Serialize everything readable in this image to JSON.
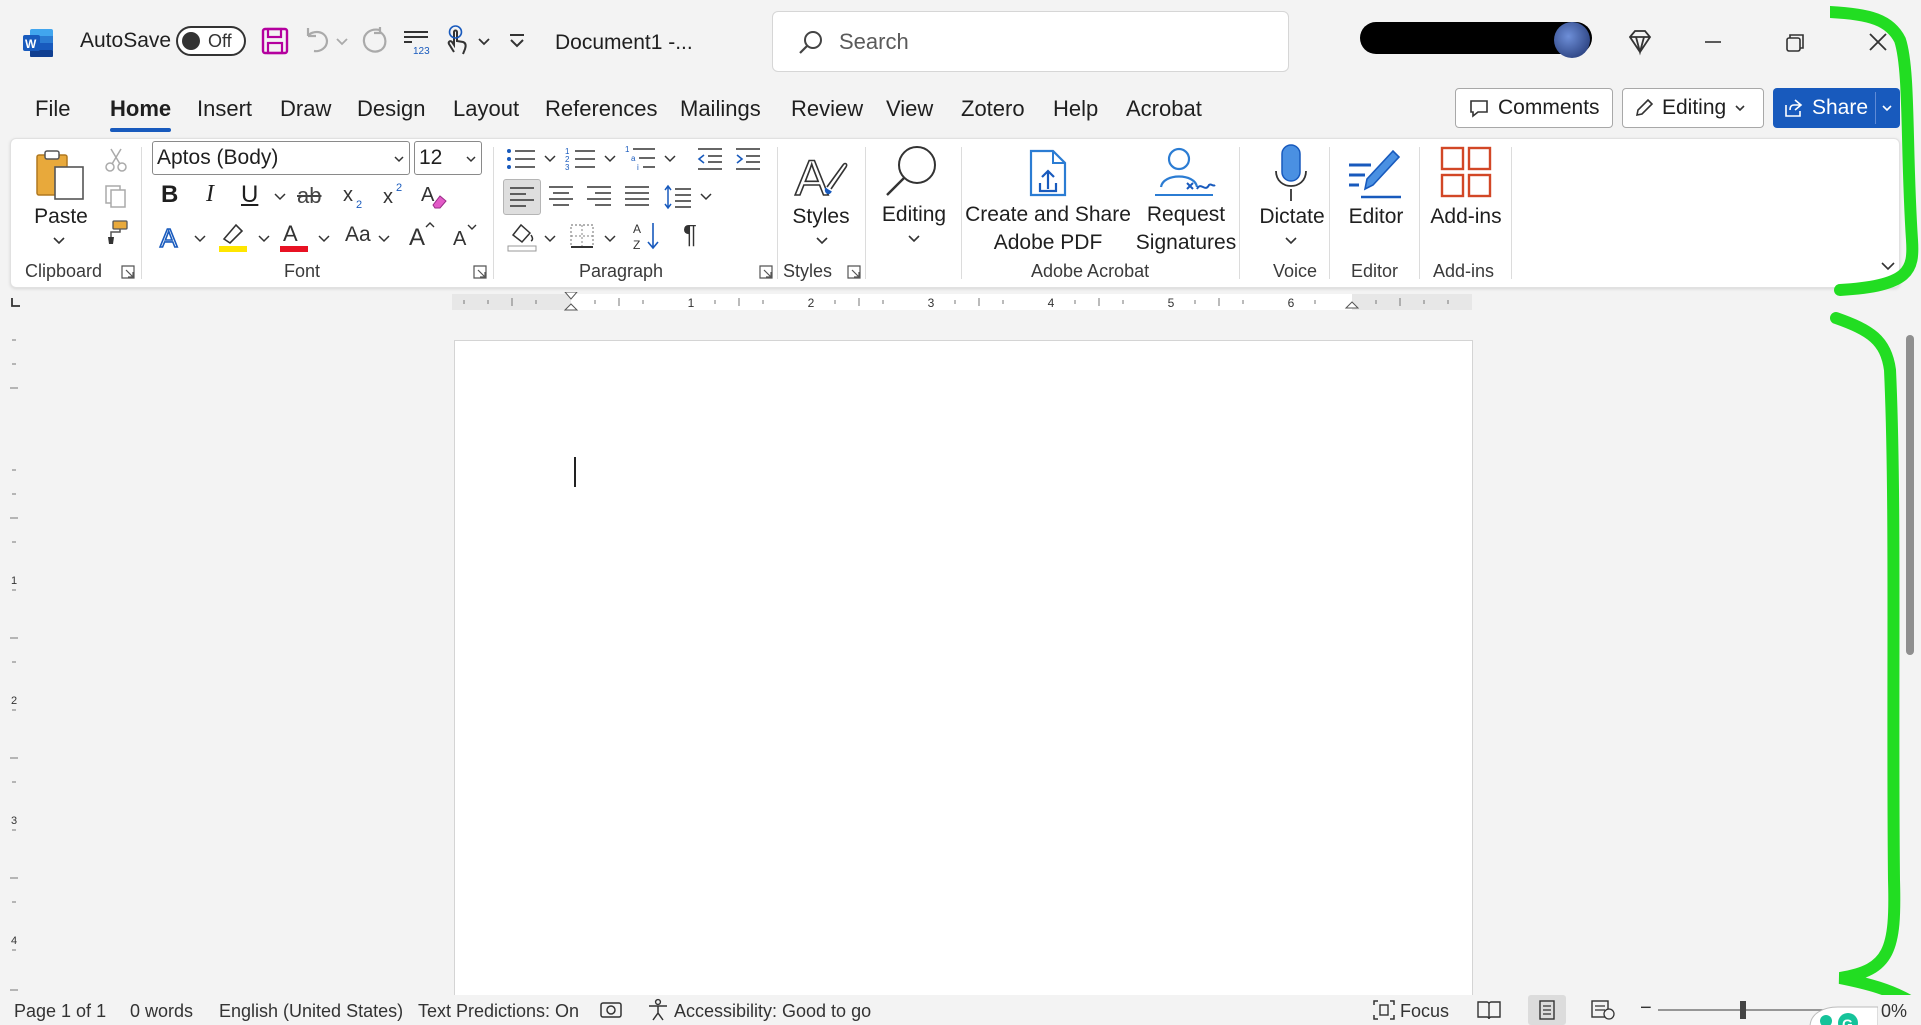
{
  "titlebar": {
    "autosave_label": "AutoSave",
    "autosave_state": "Off",
    "document_title": "Document1  -...",
    "search_placeholder": "Search"
  },
  "tabs": [
    "File",
    "Home",
    "Insert",
    "Draw",
    "Design",
    "Layout",
    "References",
    "Mailings",
    "Review",
    "View",
    "Zotero",
    "Help",
    "Acrobat"
  ],
  "active_tab": "Home",
  "actions": {
    "comments": "Comments",
    "editing": "Editing",
    "share": "Share"
  },
  "ribbon": {
    "clipboard": {
      "paste": "Paste",
      "group": "Clipboard"
    },
    "font": {
      "font_name": "Aptos (Body)",
      "font_size": "12",
      "group": "Font",
      "bold": "B",
      "italic": "I",
      "underline": "U",
      "strike": "ab",
      "change_case": "Aa"
    },
    "paragraph": {
      "group": "Paragraph"
    },
    "styles": {
      "label": "Styles",
      "group": "Styles"
    },
    "editing": {
      "label": "Editing"
    },
    "acrobat": {
      "create_share_1": "Create and Share",
      "create_share_2": "Adobe PDF",
      "request_1": "Request",
      "request_2": "Signatures",
      "group": "Adobe Acrobat"
    },
    "voice": {
      "label": "Dictate",
      "group": "Voice"
    },
    "editor": {
      "label": "Editor",
      "group": "Editor"
    },
    "addins": {
      "label": "Add-ins",
      "group": "Add-ins"
    }
  },
  "ruler_marks": [
    "1",
    "2",
    "3",
    "4",
    "5",
    "6"
  ],
  "vruler_marks": [
    "1",
    "2",
    "3",
    "4"
  ],
  "statusbar": {
    "page": "Page 1 of 1",
    "words": "0 words",
    "language": "English (United States)",
    "predictions": "Text Predictions: On",
    "accessibility": "Accessibility: Good to go",
    "focus": "Focus",
    "zoom": "0%"
  },
  "colors": {
    "accent": "#185abd",
    "annotation": "#22dd22",
    "font_color": "#e81123",
    "highlight": "#ffe600",
    "addins": "#d24726"
  }
}
